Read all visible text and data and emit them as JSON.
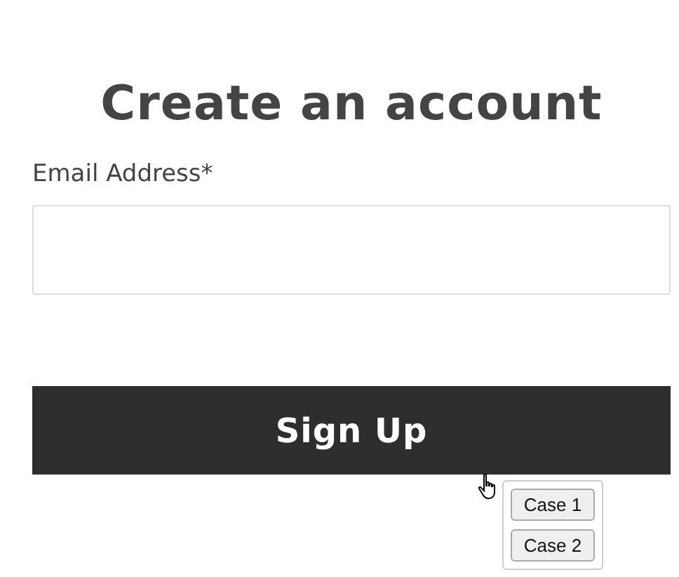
{
  "title": "Create an account",
  "email_field": {
    "label": "Email Address*"
  },
  "submit_button": {
    "label": "Sign Up"
  },
  "popup_menu": {
    "items": [
      {
        "label": "Case 1"
      },
      {
        "label": "Case 2"
      }
    ]
  }
}
